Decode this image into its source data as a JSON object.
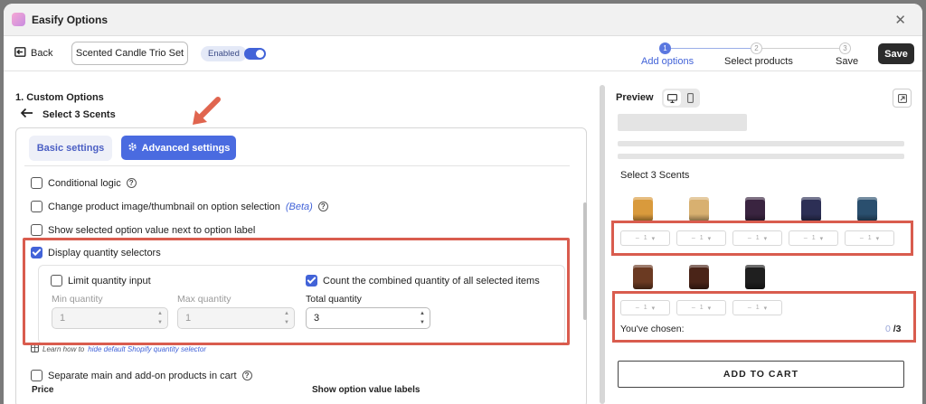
{
  "window": {
    "title": "Easify Options",
    "close_icon": "close-icon"
  },
  "topbar": {
    "back_label": "Back",
    "option_set_name": "Scented Candle Trio Set",
    "enabled_label": "Enabled",
    "enabled": true,
    "steps": [
      {
        "number": "1",
        "label": "Add options",
        "active": true
      },
      {
        "number": "2",
        "label": "Select products",
        "active": false
      },
      {
        "number": "3",
        "label": "Save",
        "active": false
      }
    ],
    "save_label": "Save"
  },
  "editor": {
    "section_title": "1. Custom Options",
    "option_title": "Select 3 Scents",
    "tabs": {
      "basic": "Basic settings",
      "advanced": "Advanced settings"
    },
    "options": {
      "conditional_logic": {
        "label": "Conditional logic",
        "checked": false
      },
      "change_image": {
        "label": "Change product image/thumbnail on option selection",
        "beta": "(Beta)",
        "checked": false
      },
      "show_value": {
        "label": "Show selected option value next to option label",
        "checked": false
      },
      "quantity_selectors": {
        "label": "Display quantity selectors",
        "checked": true
      },
      "separate_products": {
        "label": "Separate main and add-on products in cart",
        "checked": false
      }
    },
    "quantity": {
      "limit_label": "Limit quantity input",
      "limit_checked": false,
      "count_label": "Count the combined quantity of all selected items",
      "count_checked": true,
      "min_label": "Min quantity",
      "min_value": "1",
      "max_label": "Max quantity",
      "max_value": "1",
      "total_label": "Total quantity",
      "total_value": "3"
    },
    "learn": {
      "prefix": "Learn how to",
      "link": "hide default Shopify quantity selector"
    },
    "bottom_labels": {
      "price": "Price",
      "show_labels": "Show option value labels"
    }
  },
  "preview": {
    "title": "Preview",
    "option_label": "Select 3 Scents",
    "quantity_placeholder": "1",
    "chosen_label": "You've chosen:",
    "chosen_count": "0",
    "chosen_total": "/3",
    "add_to_cart": "ADD TO CART",
    "jar_colors_row1": [
      "#d99a3c",
      "#d8b070",
      "#3a2440",
      "#2c2f55",
      "#2a4f6e"
    ],
    "jar_colors_row2": [
      "#6b3a22",
      "#4a2418",
      "#1f1f1f"
    ]
  },
  "colors": {
    "accent": "#4263d8",
    "highlight": "#d95c4e",
    "save": "#2b2b2b"
  }
}
